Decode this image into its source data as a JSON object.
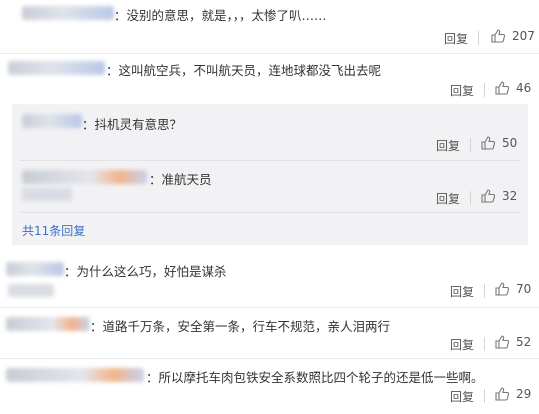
{
  "comments": [
    {
      "text": "：没别的意思，就是，，，太惨了叭……",
      "reply": "回复",
      "likes": "207"
    },
    {
      "text": "：这叫航空兵，不叫航天员，连地球都没飞出去呢",
      "reply": "回复",
      "likes": "46"
    },
    {
      "text": "：为什么这么巧，好怕是谋杀",
      "reply": "回复",
      "likes": "70"
    },
    {
      "text": "：道路千万条，安全第一条，行车不规范，亲人泪两行",
      "reply": "回复",
      "likes": "52"
    },
    {
      "text": "：所以摩托车肉包铁安全系数照比四个轮子的还是低一些啊。",
      "reply": "回复",
      "likes": "29"
    }
  ],
  "sub_replies": [
    {
      "text": "：抖机灵有意思？",
      "reply": "回复",
      "likes": "50"
    },
    {
      "text": "：准航天员",
      "reply": "回复",
      "likes": "32"
    }
  ],
  "more_replies": "共11条回复",
  "icons": {
    "like": "thumbs-up-icon"
  }
}
